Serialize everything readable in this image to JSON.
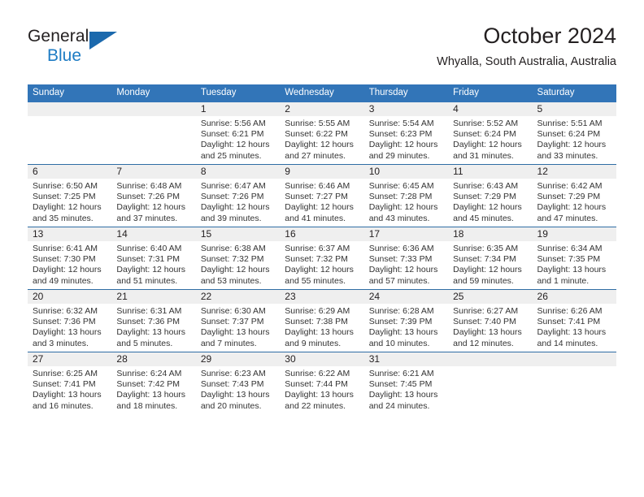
{
  "brand": {
    "name_part1": "General",
    "name_part2": "Blue",
    "logo_icon": "blue-triangle-icon"
  },
  "header": {
    "title": "October 2024",
    "location": "Whyalla, South Australia, Australia"
  },
  "colors": {
    "header_blue": "#3275b8",
    "row_divider_blue": "#2e6da4",
    "daynum_band": "#efefef",
    "brand_blue": "#1e7cc4",
    "text": "#231f20"
  },
  "weekday_headers": [
    "Sunday",
    "Monday",
    "Tuesday",
    "Wednesday",
    "Thursday",
    "Friday",
    "Saturday"
  ],
  "labels": {
    "sunrise": "Sunrise:",
    "sunset": "Sunset:",
    "daylight": "Daylight:"
  },
  "weeks": [
    [
      {
        "blank": true,
        "day": ""
      },
      {
        "blank": true,
        "day": ""
      },
      {
        "day": "1",
        "sunrise": "Sunrise: 5:56 AM",
        "sunset": "Sunset: 6:21 PM",
        "daylight_line1": "Daylight: 12 hours",
        "daylight_line2": "and 25 minutes."
      },
      {
        "day": "2",
        "sunrise": "Sunrise: 5:55 AM",
        "sunset": "Sunset: 6:22 PM",
        "daylight_line1": "Daylight: 12 hours",
        "daylight_line2": "and 27 minutes."
      },
      {
        "day": "3",
        "sunrise": "Sunrise: 5:54 AM",
        "sunset": "Sunset: 6:23 PM",
        "daylight_line1": "Daylight: 12 hours",
        "daylight_line2": "and 29 minutes."
      },
      {
        "day": "4",
        "sunrise": "Sunrise: 5:52 AM",
        "sunset": "Sunset: 6:24 PM",
        "daylight_line1": "Daylight: 12 hours",
        "daylight_line2": "and 31 minutes."
      },
      {
        "day": "5",
        "sunrise": "Sunrise: 5:51 AM",
        "sunset": "Sunset: 6:24 PM",
        "daylight_line1": "Daylight: 12 hours",
        "daylight_line2": "and 33 minutes."
      }
    ],
    [
      {
        "day": "6",
        "sunrise": "Sunrise: 6:50 AM",
        "sunset": "Sunset: 7:25 PM",
        "daylight_line1": "Daylight: 12 hours",
        "daylight_line2": "and 35 minutes."
      },
      {
        "day": "7",
        "sunrise": "Sunrise: 6:48 AM",
        "sunset": "Sunset: 7:26 PM",
        "daylight_line1": "Daylight: 12 hours",
        "daylight_line2": "and 37 minutes."
      },
      {
        "day": "8",
        "sunrise": "Sunrise: 6:47 AM",
        "sunset": "Sunset: 7:26 PM",
        "daylight_line1": "Daylight: 12 hours",
        "daylight_line2": "and 39 minutes."
      },
      {
        "day": "9",
        "sunrise": "Sunrise: 6:46 AM",
        "sunset": "Sunset: 7:27 PM",
        "daylight_line1": "Daylight: 12 hours",
        "daylight_line2": "and 41 minutes."
      },
      {
        "day": "10",
        "sunrise": "Sunrise: 6:45 AM",
        "sunset": "Sunset: 7:28 PM",
        "daylight_line1": "Daylight: 12 hours",
        "daylight_line2": "and 43 minutes."
      },
      {
        "day": "11",
        "sunrise": "Sunrise: 6:43 AM",
        "sunset": "Sunset: 7:29 PM",
        "daylight_line1": "Daylight: 12 hours",
        "daylight_line2": "and 45 minutes."
      },
      {
        "day": "12",
        "sunrise": "Sunrise: 6:42 AM",
        "sunset": "Sunset: 7:29 PM",
        "daylight_line1": "Daylight: 12 hours",
        "daylight_line2": "and 47 minutes."
      }
    ],
    [
      {
        "day": "13",
        "sunrise": "Sunrise: 6:41 AM",
        "sunset": "Sunset: 7:30 PM",
        "daylight_line1": "Daylight: 12 hours",
        "daylight_line2": "and 49 minutes."
      },
      {
        "day": "14",
        "sunrise": "Sunrise: 6:40 AM",
        "sunset": "Sunset: 7:31 PM",
        "daylight_line1": "Daylight: 12 hours",
        "daylight_line2": "and 51 minutes."
      },
      {
        "day": "15",
        "sunrise": "Sunrise: 6:38 AM",
        "sunset": "Sunset: 7:32 PM",
        "daylight_line1": "Daylight: 12 hours",
        "daylight_line2": "and 53 minutes."
      },
      {
        "day": "16",
        "sunrise": "Sunrise: 6:37 AM",
        "sunset": "Sunset: 7:32 PM",
        "daylight_line1": "Daylight: 12 hours",
        "daylight_line2": "and 55 minutes."
      },
      {
        "day": "17",
        "sunrise": "Sunrise: 6:36 AM",
        "sunset": "Sunset: 7:33 PM",
        "daylight_line1": "Daylight: 12 hours",
        "daylight_line2": "and 57 minutes."
      },
      {
        "day": "18",
        "sunrise": "Sunrise: 6:35 AM",
        "sunset": "Sunset: 7:34 PM",
        "daylight_line1": "Daylight: 12 hours",
        "daylight_line2": "and 59 minutes."
      },
      {
        "day": "19",
        "sunrise": "Sunrise: 6:34 AM",
        "sunset": "Sunset: 7:35 PM",
        "daylight_line1": "Daylight: 13 hours",
        "daylight_line2": "and 1 minute."
      }
    ],
    [
      {
        "day": "20",
        "sunrise": "Sunrise: 6:32 AM",
        "sunset": "Sunset: 7:36 PM",
        "daylight_line1": "Daylight: 13 hours",
        "daylight_line2": "and 3 minutes."
      },
      {
        "day": "21",
        "sunrise": "Sunrise: 6:31 AM",
        "sunset": "Sunset: 7:36 PM",
        "daylight_line1": "Daylight: 13 hours",
        "daylight_line2": "and 5 minutes."
      },
      {
        "day": "22",
        "sunrise": "Sunrise: 6:30 AM",
        "sunset": "Sunset: 7:37 PM",
        "daylight_line1": "Daylight: 13 hours",
        "daylight_line2": "and 7 minutes."
      },
      {
        "day": "23",
        "sunrise": "Sunrise: 6:29 AM",
        "sunset": "Sunset: 7:38 PM",
        "daylight_line1": "Daylight: 13 hours",
        "daylight_line2": "and 9 minutes."
      },
      {
        "day": "24",
        "sunrise": "Sunrise: 6:28 AM",
        "sunset": "Sunset: 7:39 PM",
        "daylight_line1": "Daylight: 13 hours",
        "daylight_line2": "and 10 minutes."
      },
      {
        "day": "25",
        "sunrise": "Sunrise: 6:27 AM",
        "sunset": "Sunset: 7:40 PM",
        "daylight_line1": "Daylight: 13 hours",
        "daylight_line2": "and 12 minutes."
      },
      {
        "day": "26",
        "sunrise": "Sunrise: 6:26 AM",
        "sunset": "Sunset: 7:41 PM",
        "daylight_line1": "Daylight: 13 hours",
        "daylight_line2": "and 14 minutes."
      }
    ],
    [
      {
        "day": "27",
        "sunrise": "Sunrise: 6:25 AM",
        "sunset": "Sunset: 7:41 PM",
        "daylight_line1": "Daylight: 13 hours",
        "daylight_line2": "and 16 minutes."
      },
      {
        "day": "28",
        "sunrise": "Sunrise: 6:24 AM",
        "sunset": "Sunset: 7:42 PM",
        "daylight_line1": "Daylight: 13 hours",
        "daylight_line2": "and 18 minutes."
      },
      {
        "day": "29",
        "sunrise": "Sunrise: 6:23 AM",
        "sunset": "Sunset: 7:43 PM",
        "daylight_line1": "Daylight: 13 hours",
        "daylight_line2": "and 20 minutes."
      },
      {
        "day": "30",
        "sunrise": "Sunrise: 6:22 AM",
        "sunset": "Sunset: 7:44 PM",
        "daylight_line1": "Daylight: 13 hours",
        "daylight_line2": "and 22 minutes."
      },
      {
        "day": "31",
        "sunrise": "Sunrise: 6:21 AM",
        "sunset": "Sunset: 7:45 PM",
        "daylight_line1": "Daylight: 13 hours",
        "daylight_line2": "and 24 minutes."
      },
      {
        "blank": true,
        "day": ""
      },
      {
        "blank": true,
        "day": ""
      }
    ]
  ]
}
